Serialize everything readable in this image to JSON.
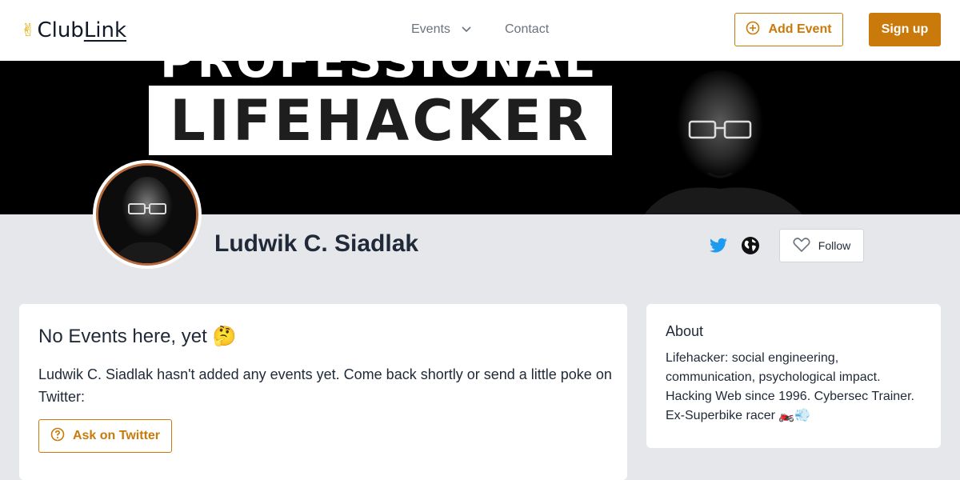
{
  "header": {
    "logo_emoji": "✌",
    "logo_part1": "Club",
    "logo_part2": "Link",
    "nav": {
      "events_label": "Events",
      "contact_label": "Contact"
    },
    "add_event_label": "Add Event",
    "signup_label": "Sign up"
  },
  "banner": {
    "top_text": "PROFESSIONAL",
    "box_text": "LIFEHACKER"
  },
  "profile": {
    "name": "Ludwik C. Siadlak",
    "follow_label": "Follow"
  },
  "events_card": {
    "title": "No Events here, yet 🤔",
    "message": "Ludwik C. Siadlak hasn't added any events yet. Come back shortly or send a little poke on Twitter:",
    "ask_button_label": "Ask on Twitter"
  },
  "about_card": {
    "title": "About",
    "text": "Lifehacker: social engineering, communication, psychological impact. Hacking Web since 1996. Cybersec Trainer. Ex-Superbike racer 🏍️💨"
  },
  "colors": {
    "accent": "#c97a0a",
    "page_background": "#e5e7eb",
    "twitter_blue": "#1d9bf0"
  },
  "icons": {
    "logo": "victory-hand-icon",
    "events_dropdown": "chevron-down-icon",
    "add_event": "plus-circle-icon",
    "twitter": "twitter-icon",
    "website": "globe-icon",
    "follow": "heart-icon",
    "ask": "question-circle-icon"
  }
}
